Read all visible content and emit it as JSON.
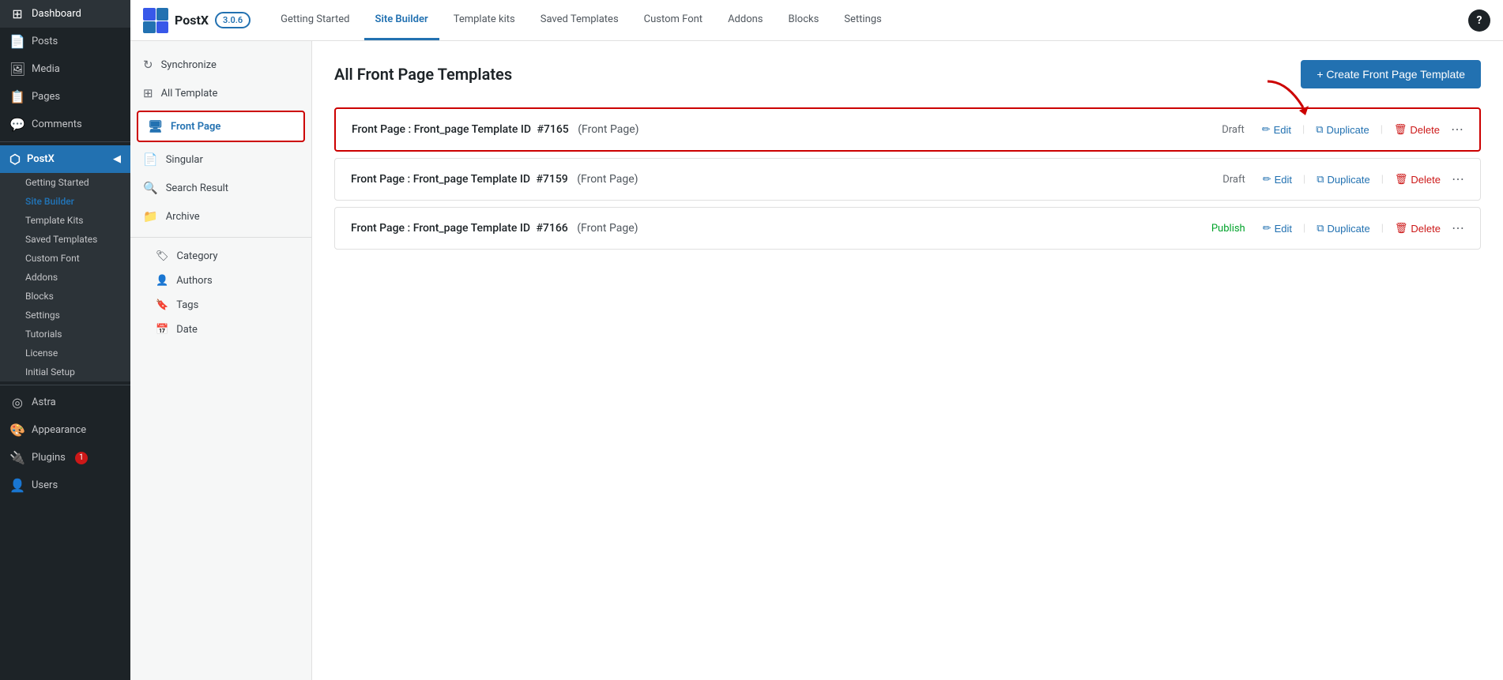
{
  "wp_sidebar": {
    "items": [
      {
        "id": "dashboard",
        "label": "Dashboard",
        "icon": "⊞"
      },
      {
        "id": "posts",
        "label": "Posts",
        "icon": "📄"
      },
      {
        "id": "media",
        "label": "Media",
        "icon": "🖼"
      },
      {
        "id": "pages",
        "label": "Pages",
        "icon": "📋"
      },
      {
        "id": "comments",
        "label": "Comments",
        "icon": "💬"
      }
    ],
    "postx": {
      "label": "PostX",
      "sub_items": [
        {
          "id": "getting-started",
          "label": "Getting Started"
        },
        {
          "id": "site-builder",
          "label": "Site Builder"
        },
        {
          "id": "template-kits",
          "label": "Template Kits"
        },
        {
          "id": "saved-templates",
          "label": "Saved Templates"
        },
        {
          "id": "custom-font",
          "label": "Custom Font"
        },
        {
          "id": "addons",
          "label": "Addons"
        },
        {
          "id": "blocks",
          "label": "Blocks"
        },
        {
          "id": "settings",
          "label": "Settings"
        },
        {
          "id": "tutorials",
          "label": "Tutorials"
        },
        {
          "id": "license",
          "label": "License"
        },
        {
          "id": "initial-setup",
          "label": "Initial Setup"
        }
      ]
    },
    "bottom_items": [
      {
        "id": "astra",
        "label": "Astra",
        "icon": "◎"
      },
      {
        "id": "appearance",
        "label": "Appearance",
        "icon": "🎨"
      },
      {
        "id": "plugins",
        "label": "Plugins",
        "icon": "🔌",
        "badge": "1"
      },
      {
        "id": "users",
        "label": "Users",
        "icon": "👤"
      }
    ]
  },
  "top_nav": {
    "logo_text": "PostX",
    "version": "3.0.6",
    "tabs": [
      {
        "id": "getting-started",
        "label": "Getting Started",
        "active": false
      },
      {
        "id": "site-builder",
        "label": "Site Builder",
        "active": true
      },
      {
        "id": "template-kits",
        "label": "Template kits",
        "active": false
      },
      {
        "id": "saved-templates",
        "label": "Saved Templates",
        "active": false
      },
      {
        "id": "custom-font",
        "label": "Custom Font",
        "active": false
      },
      {
        "id": "addons",
        "label": "Addons",
        "active": false
      },
      {
        "id": "blocks",
        "label": "Blocks",
        "active": false
      },
      {
        "id": "settings",
        "label": "Settings",
        "active": false
      }
    ],
    "help_icon": "?"
  },
  "secondary_sidebar": {
    "items": [
      {
        "id": "synchronize",
        "label": "Synchronize",
        "icon": "↻",
        "active": false
      },
      {
        "id": "all-template",
        "label": "All Template",
        "icon": "⊞",
        "active": false
      },
      {
        "id": "front-page",
        "label": "Front Page",
        "icon": "🖥",
        "active": true
      },
      {
        "id": "singular",
        "label": "Singular",
        "icon": "📄",
        "active": false
      },
      {
        "id": "search-result",
        "label": "Search Result",
        "icon": "🔍",
        "active": false
      },
      {
        "id": "archive",
        "label": "Archive",
        "icon": "📁",
        "active": false
      }
    ],
    "sub_items": [
      {
        "id": "category",
        "label": "Category",
        "icon": "🏷"
      },
      {
        "id": "authors",
        "label": "Authors",
        "icon": "👤"
      },
      {
        "id": "tags",
        "label": "Tags",
        "icon": "🔖"
      },
      {
        "id": "date",
        "label": "Date",
        "icon": "📅"
      }
    ]
  },
  "page": {
    "title": "All Front Page Templates",
    "create_btn_label": "+ Create Front Page Template",
    "templates": [
      {
        "id": 1,
        "title": "Front Page",
        "colon": ":",
        "name": "Front_page Template ID",
        "id_hash": "#7165",
        "tag": "(Front Page)",
        "status": "Draft",
        "highlighted": true,
        "actions": [
          "Edit",
          "Duplicate",
          "Delete"
        ]
      },
      {
        "id": 2,
        "title": "Front Page",
        "colon": ":",
        "name": "Front_page Template ID",
        "id_hash": "#7159",
        "tag": "(Front Page)",
        "status": "Draft",
        "highlighted": false,
        "actions": [
          "Edit",
          "Duplicate",
          "Delete"
        ]
      },
      {
        "id": 3,
        "title": "Front Page",
        "colon": ":",
        "name": "Front_page Template ID",
        "id_hash": "#7166",
        "tag": "(Front Page)",
        "status": "Publish",
        "highlighted": false,
        "actions": [
          "Edit",
          "Duplicate",
          "Delete"
        ]
      }
    ]
  },
  "icons": {
    "edit": "✏",
    "duplicate": "⧉",
    "delete": "🗑",
    "more": "⋯",
    "sync": "↻",
    "grid": "⊞",
    "monitor": "🖥",
    "doc": "📄",
    "search": "🔍",
    "folder": "📁",
    "tag": "🏷",
    "user": "👤",
    "bookmark": "🔖",
    "calendar": "📅",
    "astra": "◎",
    "paint": "🎨",
    "plugin": "🔌"
  }
}
